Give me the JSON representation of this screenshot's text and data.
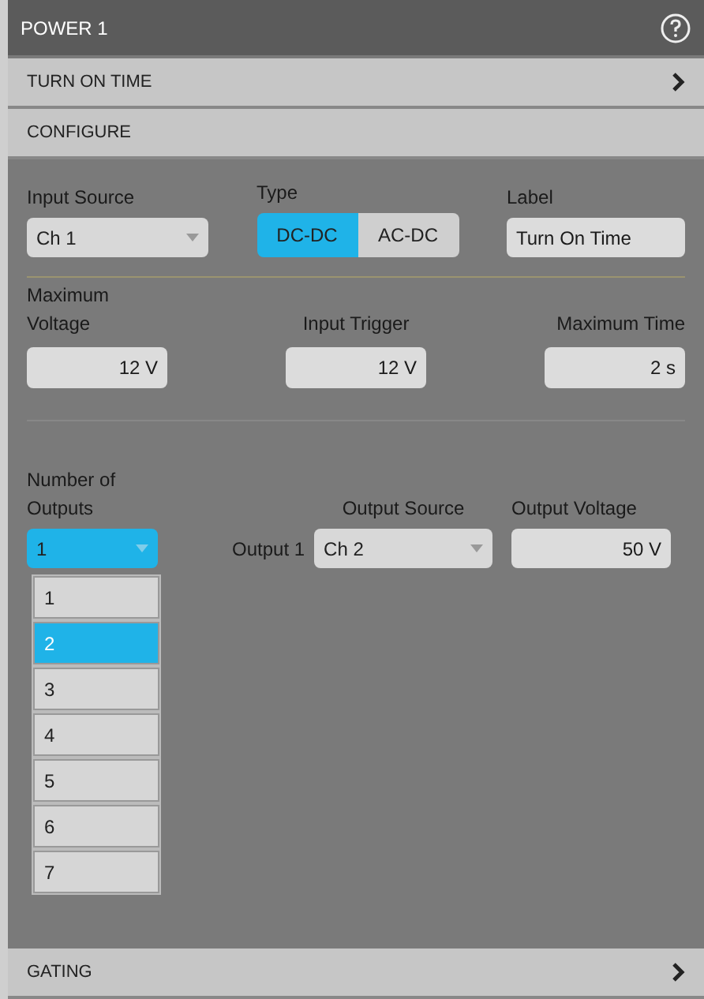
{
  "header": {
    "title": "POWER 1"
  },
  "sections": [
    {
      "title": "TURN ON TIME",
      "expanded": false
    },
    {
      "title": "CONFIGURE",
      "expanded": true
    }
  ],
  "input_source": {
    "label": "Input Source",
    "value": "Ch 1"
  },
  "type": {
    "label": "Type",
    "options": [
      {
        "label": "DC-DC",
        "selected": true
      },
      {
        "label": "AC-DC",
        "selected": false
      }
    ]
  },
  "label_field": {
    "label": "Label",
    "value": "Turn On Time"
  },
  "limits": [
    {
      "label": "Maximum Voltage",
      "value": "12 V"
    },
    {
      "label": "Input Trigger",
      "value": "12 V"
    },
    {
      "label": "Maximum Time",
      "value": "2 s"
    }
  ],
  "outputs": {
    "label": "Number of Outputs",
    "value": "1",
    "expanded": true,
    "options": [
      {
        "label": "1",
        "highlighted": false
      },
      {
        "label": "2",
        "highlighted": true
      },
      {
        "label": "3",
        "highlighted": false
      },
      {
        "label": "4",
        "highlighted": false
      },
      {
        "label": "5",
        "highlighted": false
      },
      {
        "label": "6",
        "highlighted": false
      },
      {
        "label": "7",
        "highlighted": false
      }
    ]
  },
  "output_rows": [
    {
      "name": "Output 1",
      "source": "Ch 2",
      "voltage": "50 V"
    }
  ],
  "output_source_label": "Output Source",
  "output_voltage_label": "Output Voltage",
  "footer_section": {
    "title": "GATING",
    "expanded": false
  }
}
